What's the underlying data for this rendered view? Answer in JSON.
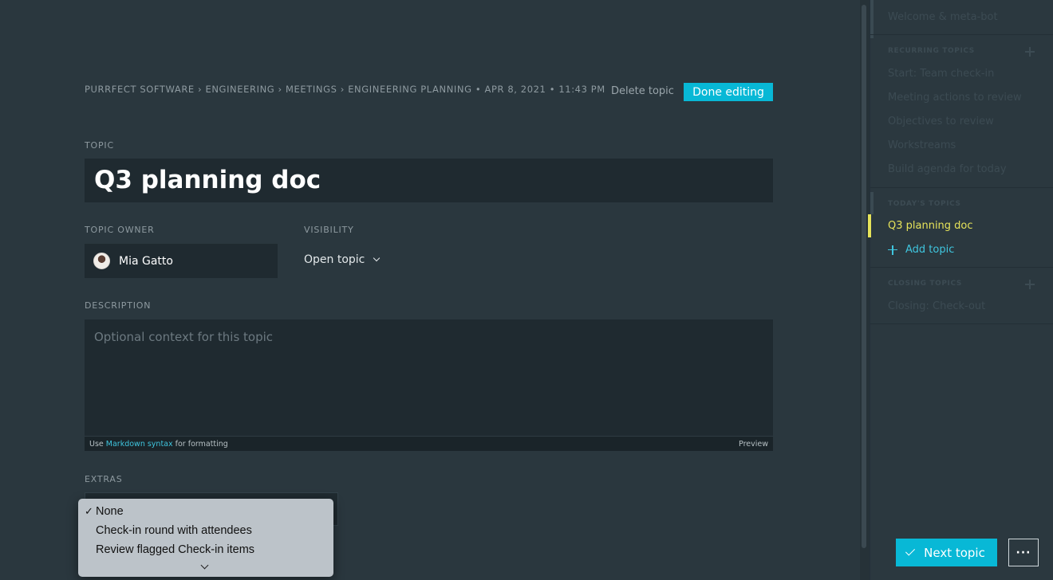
{
  "breadcrumb": "PURRFECT SOFTWARE › ENGINEERING › MEETINGS › ENGINEERING PLANNING • APR 8, 2021 • 11:43 PM",
  "actions": {
    "delete_label": "Delete topic",
    "done_label": "Done editing"
  },
  "topic": {
    "label": "TOPIC",
    "title": "Q3 planning doc"
  },
  "owner": {
    "label": "TOPIC OWNER",
    "name": "Mia Gatto"
  },
  "visibility": {
    "label": "VISIBILITY",
    "value": "Open topic"
  },
  "description": {
    "label": "DESCRIPTION",
    "placeholder": "Optional context for this topic",
    "footer_prefix": "Use ",
    "footer_link": "Markdown syntax",
    "footer_suffix": " for formatting",
    "preview_label": "Preview"
  },
  "extras": {
    "label": "EXTRAS",
    "options": [
      {
        "label": "None",
        "selected": true
      },
      {
        "label": "Check-in round with attendees",
        "selected": false
      },
      {
        "label": "Review flagged Check-in items",
        "selected": false
      }
    ],
    "check_glyph": "✓"
  },
  "sidebar": {
    "top_item": "Welcome & meta-bot",
    "recurring_header": "RECURRING TOPICS",
    "recurring_items": [
      "Start: Team check-in",
      "Meeting actions to review",
      "Objectives to review",
      "Workstreams",
      "Build agenda for today"
    ],
    "today_header": "TODAY'S TOPICS",
    "today_active": "Q3 planning doc",
    "add_topic": "Add topic",
    "closing_header": "CLOSING TOPICS",
    "closing_items": [
      "Closing: Check-out"
    ]
  },
  "footer": {
    "next_label": "Next topic",
    "more_label": "···"
  },
  "colors": {
    "accent": "#08b8d6",
    "active_topic": "#e6e35a",
    "background": "#2a373e"
  }
}
